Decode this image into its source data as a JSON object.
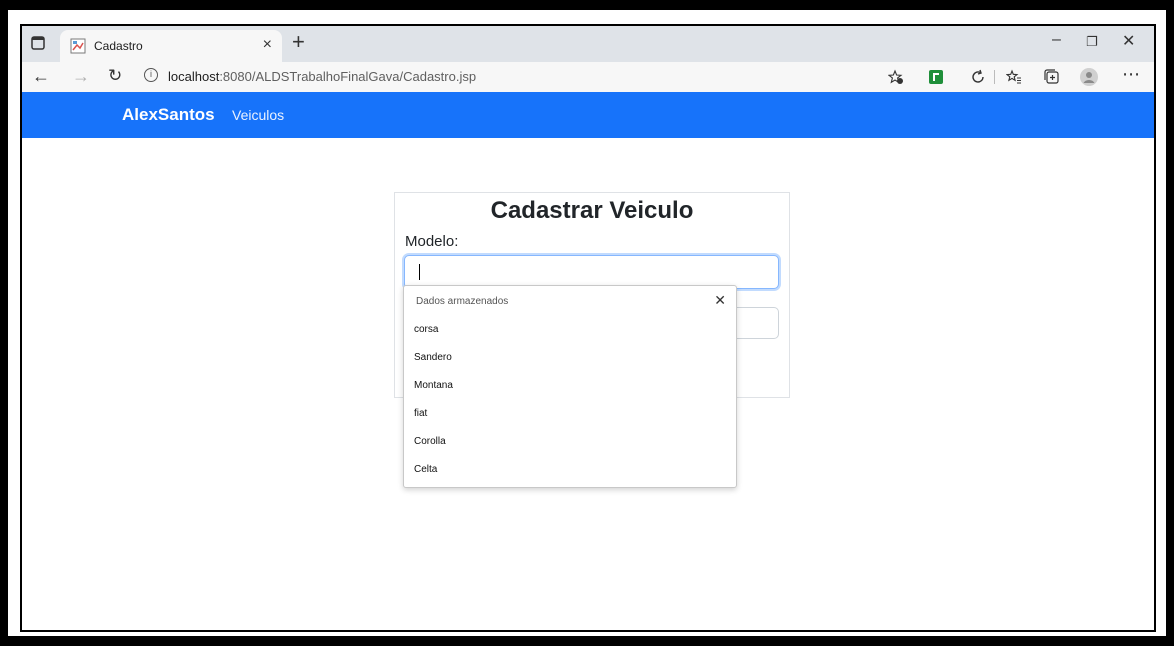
{
  "browser": {
    "tab_title": "Cadastro",
    "url_host": "localhost",
    "url_path": ":8080/ALDSTrabalhoFinalGava/Cadastro.jsp"
  },
  "navbar": {
    "brand": "AlexSantos",
    "link": "Veiculos",
    "color": "#1773fa"
  },
  "form": {
    "title": "Cadastrar Veiculo",
    "modelo_label": "Modelo:",
    "modelo_value": ""
  },
  "autofill": {
    "header": "Dados armazenados",
    "items": [
      "corsa",
      "Sandero",
      "Montana",
      "fiat",
      "Corolla",
      "Celta"
    ]
  }
}
